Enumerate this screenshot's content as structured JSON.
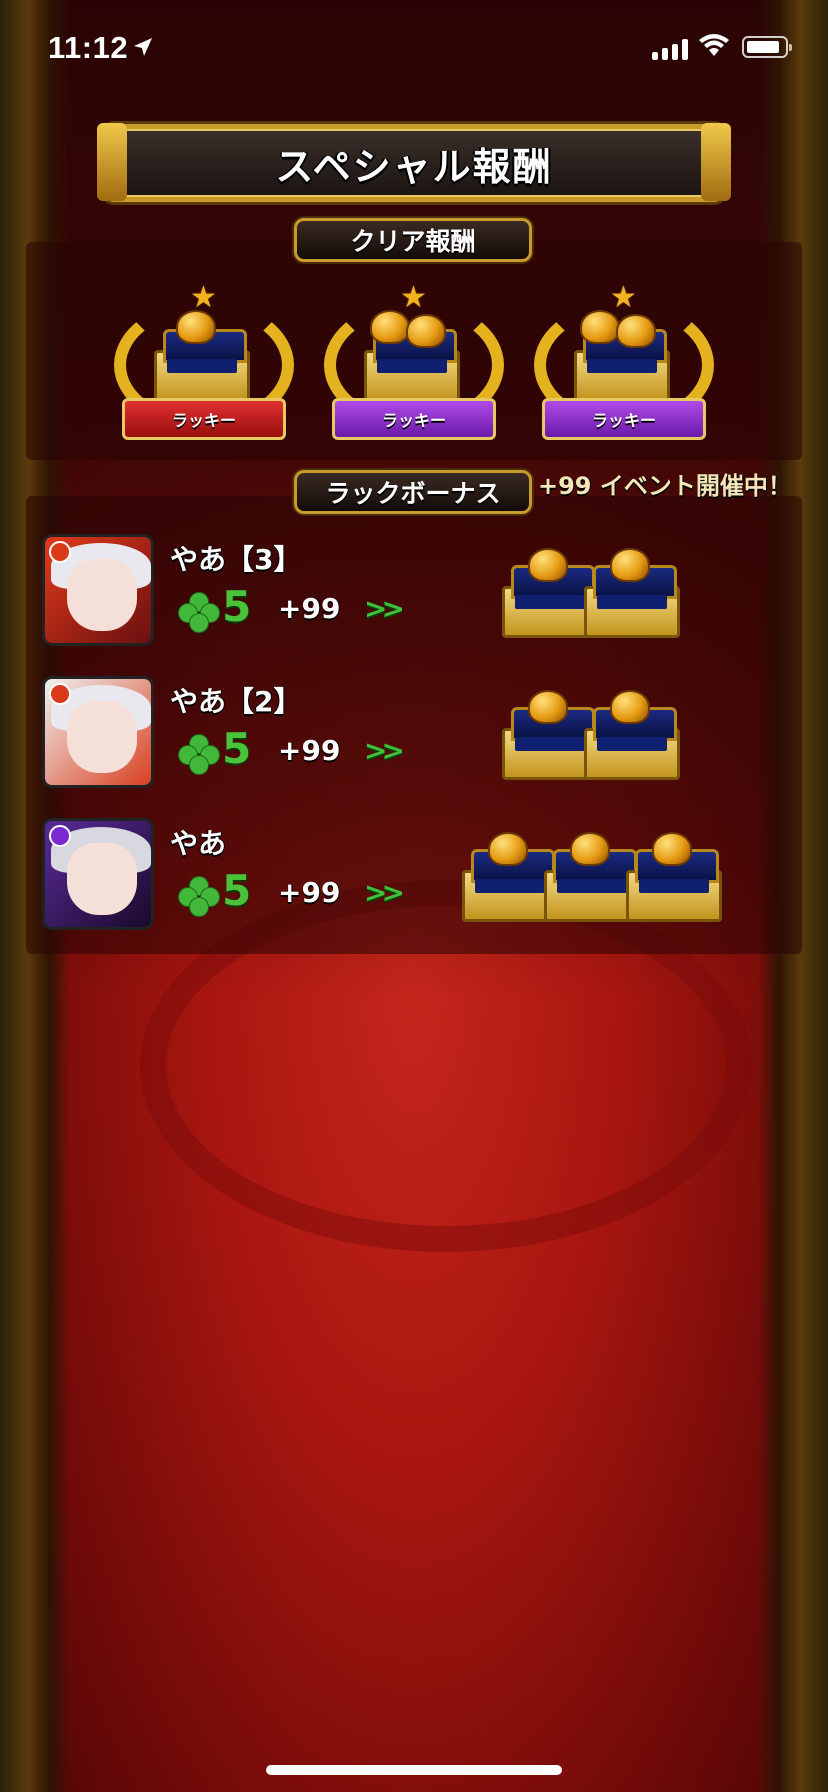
{
  "status_bar": {
    "time": "11:12"
  },
  "title": "スペシャル報酬",
  "clear_reward": {
    "label": "クリア報酬",
    "badges": [
      {
        "label": "ラッキー",
        "color": "#c81e1e",
        "chests": 1
      },
      {
        "label": "ラッキー",
        "color": "#8a2ad0",
        "chests": 2
      },
      {
        "label": "ラッキー",
        "color": "#8a2ad0",
        "chests": 2
      }
    ]
  },
  "luck_bonus": {
    "label": "ラックボーナス",
    "event_note": "+99 イベント開催中！",
    "rows": [
      {
        "name": "やあ【3】",
        "luck": "5",
        "bonus": "+99",
        "arrows": ">>",
        "chests": 2
      },
      {
        "name": "やあ【2】",
        "luck": "5",
        "bonus": "+99",
        "arrows": ">>",
        "chests": 2
      },
      {
        "name": "やあ",
        "luck": "5",
        "bonus": "+99",
        "arrows": ">>",
        "chests": 3
      }
    ]
  },
  "colors": {
    "gold": "#c89a2a",
    "luck_green": "#4ac33a",
    "background_red": "#a8160f"
  }
}
